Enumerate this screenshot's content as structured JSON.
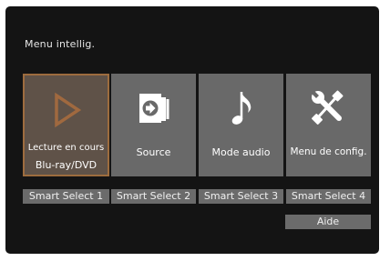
{
  "menu": {
    "title": "Menu intellig."
  },
  "tiles": [
    {
      "line1": "Lecture en cours",
      "line2": "Blu-ray/DVD",
      "icon": "play-icon",
      "selected": true
    },
    {
      "label": "Source",
      "icon": "source-icon"
    },
    {
      "label": "Mode audio",
      "icon": "music-note-icon"
    },
    {
      "label": "Menu de config.",
      "icon": "tools-icon"
    }
  ],
  "smart_select": [
    "Smart Select 1",
    "Smart Select 2",
    "Smart Select 3",
    "Smart Select 4"
  ],
  "help": {
    "label": "Aide"
  },
  "colors": {
    "background": "#141414",
    "tile": "#696969",
    "tile_selected": "#5f5248",
    "selected_border": "#9d6c3e",
    "icon_selected": "#a0693f"
  }
}
